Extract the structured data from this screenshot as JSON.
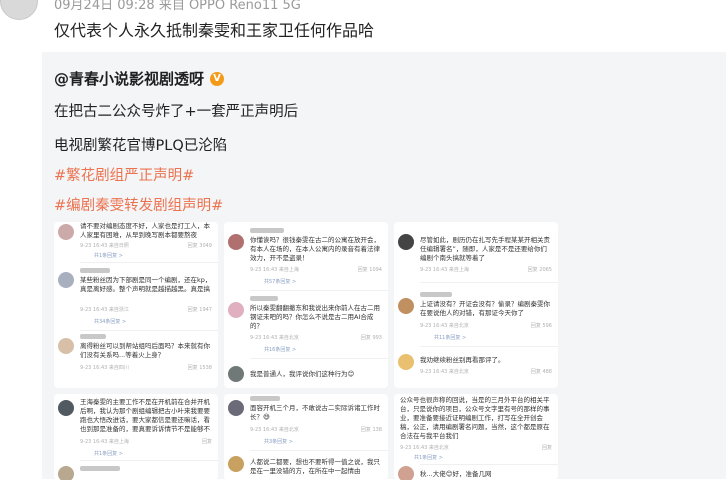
{
  "post": {
    "meta": "09月24日 09:28  来自 OPPO Reno11 5G",
    "text": "仅代表个人永久抵制秦雯和王家卫任何作品哈"
  },
  "repost": {
    "author": "@青春小说影视剧透呀",
    "badge": "V",
    "lines": [
      "在把古二公众号炸了+一套严正声明后",
      "电视剧繁花官博PLQ已沦陷"
    ],
    "tags": [
      "#繁花剧组严正声明#",
      "#编剧秦雯转发剧组声明#"
    ]
  },
  "cards": [
    {
      "comments": [
        {
          "text": "请不要对编剧态度不好，人家也是打工人，本人家里有困难，从早到晚写剧本都要熬夜mean",
          "meta": "9-23 16:43 来自日照",
          "acts": "回复  3049",
          "reply": "共1条回复 >"
        },
        {
          "text": "某些粉丝因为下部剧是同一个编剧，还在kp，真是离好感。整个声明就是越描越黑。真是搞得",
          "meta": "9-23 16:43 来自浙江",
          "acts": "回复  1947",
          "reply": "共34条回复 >"
        },
        {
          "text": "离得粉丝可以到帮站组吗后面吗？本来就有你们没有关系吗...等着火上身？",
          "meta": "9-23 16:43 来自四川",
          "acts": "回复  1538",
          "reply": ""
        }
      ]
    },
    {
      "comments": [
        {
          "text": "你懂诶吗？很钱秦雯在古二的公寓在放开会，有本人在场的，在本人公寓内的录音有着法律效力，开不是盗录！",
          "meta": "9-23 16:43 来自上海",
          "acts": "回复  1094",
          "reply": "共57条回复 >"
        },
        {
          "text": "所以秦雯翻翻撤东和我说出来你前人在古二用钢证未吧的吗？你怎么不说是古二用AI合成的？",
          "meta": "9-23 16:43 来自北京",
          "acts": "回复  993",
          "reply": "共16条回复 >"
        },
        {
          "text": "我是普通人，我评说你们这种行为😊",
          "meta": "",
          "acts": "",
          "reply": ""
        }
      ]
    },
    {
      "comments": [
        {
          "text": "尽管如此，剧历仍在扎写先手程某某开相关责任编辑署名”，随即，人家是不是还要给你们编剧个南头搞就等着了",
          "meta": "9-23 16:43 来自上海",
          "acts": "回复  2065",
          "reply": ""
        },
        {
          "text": "上证请没有？开证会没有？偷录？编剧秦雯你在要说他人的对错，有那证今天你了",
          "meta": "9-23 16:43 来自北京",
          "acts": "回复  596",
          "reply": "共11条回复 >"
        },
        {
          "text": "我劝继续粉丝别再看那评了。",
          "meta": "9-23 16:43 来自北京",
          "acts": "回复  488",
          "reply": ""
        }
      ]
    },
    {
      "comments": [
        {
          "text": "王海秦雯的主要工作不是在开机前在合并开机后啊，我认为那个剧组编辑把古小叶来我要要跑也大悟改进话，要大家都信是要还嘛话，看也到那是准备的，要真要诉诉情节不是能够不能给不好",
          "meta": "9-23 16:43 来自上海",
          "acts": "回复",
          "reply": "共1条回复 >"
        },
        {
          "text": "",
          "meta": "",
          "acts": "",
          "reply": ""
        }
      ]
    },
    {
      "comments": [
        {
          "text": "面容开机三个月，不敢说古二实际诉诸工作时长？😅",
          "meta": "9-23 16:43 来自北京",
          "acts": "回复  138",
          "reply": "共3条回复 >"
        },
        {
          "text": "人都说二都要，想也不要听得一值之说，我只是在一里没错的方，在所在中一起情由",
          "meta": "",
          "acts": "",
          "reply": ""
        }
      ]
    },
    {
      "comments": [
        {
          "text": "公众号也很声称的回说，当是的三月外平台的相关平台，只是说你的项目，公众号文字里有号的那样的事业，要准备要接近证明编剧工作，打写在全开创会稿，公正，请用编剧署名问题，当然，这个都是原在合法在与我平台我们",
          "meta": "9-23 16:43 来自北京",
          "acts": "回复",
          "reply": "共1条回复 >"
        },
        {
          "text": "秋...大佬😊好，准备几网",
          "meta": "",
          "acts": "",
          "reply": ""
        }
      ]
    }
  ],
  "colors": {
    "tag": "#eb7350",
    "badge": "#f39b18",
    "repost_bg": "#f4f5f7"
  }
}
